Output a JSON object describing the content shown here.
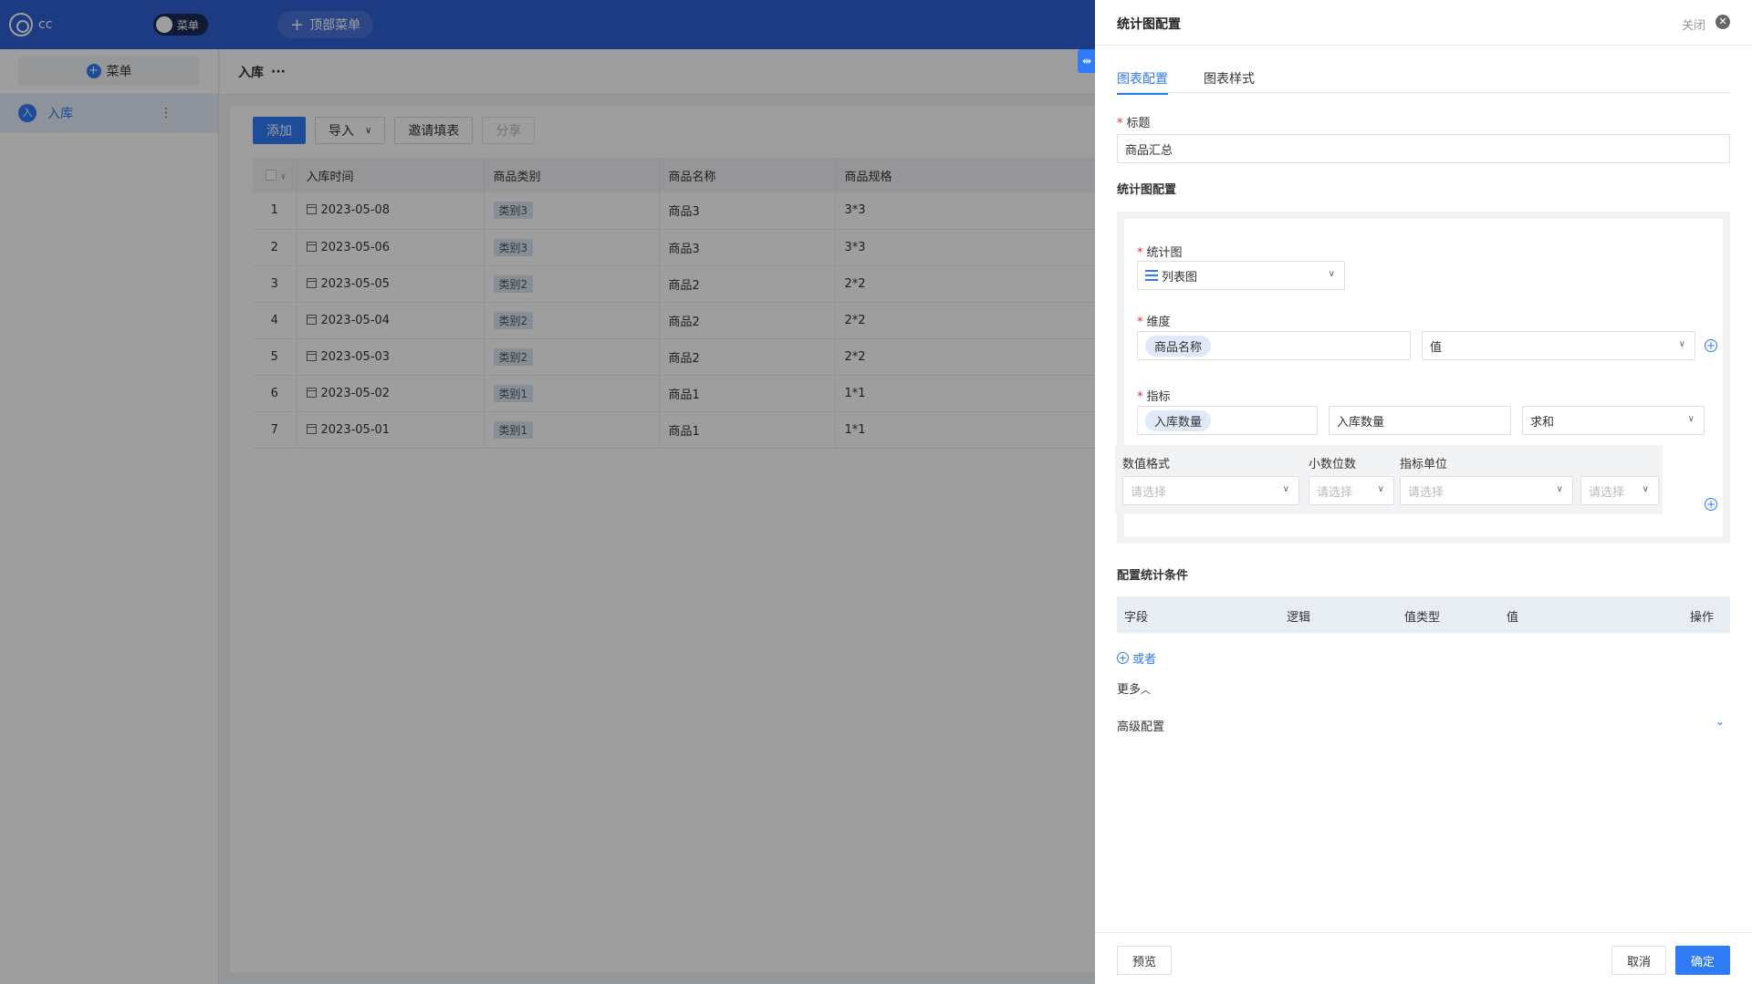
{
  "app": {
    "logo_text": "cc",
    "toggle_label": "菜单",
    "top_menu_label": "顶部菜单"
  },
  "sidebar": {
    "menu_button": "菜单",
    "items": [
      {
        "badge": "入",
        "label": "入库",
        "more": "⋮"
      }
    ]
  },
  "page": {
    "title": "入库",
    "more": "···"
  },
  "toolbar": {
    "add": "添加",
    "import": "导入",
    "invite": "邀请填表",
    "share": "分享"
  },
  "table": {
    "columns": [
      "入库时间",
      "商品类别",
      "商品名称",
      "商品规格"
    ],
    "rows": [
      {
        "idx": "1",
        "date": "2023-05-08",
        "category": "类别3",
        "name": "商品3",
        "spec": "3*3"
      },
      {
        "idx": "2",
        "date": "2023-05-06",
        "category": "类别3",
        "name": "商品3",
        "spec": "3*3"
      },
      {
        "idx": "3",
        "date": "2023-05-05",
        "category": "类别2",
        "name": "商品2",
        "spec": "2*2"
      },
      {
        "idx": "4",
        "date": "2023-05-04",
        "category": "类别2",
        "name": "商品2",
        "spec": "2*2"
      },
      {
        "idx": "5",
        "date": "2023-05-03",
        "category": "类别2",
        "name": "商品2",
        "spec": "2*2"
      },
      {
        "idx": "6",
        "date": "2023-05-02",
        "category": "类别1",
        "name": "商品1",
        "spec": "1*1"
      },
      {
        "idx": "7",
        "date": "2023-05-01",
        "category": "类别1",
        "name": "商品1",
        "spec": "1*1"
      }
    ]
  },
  "drawer": {
    "title": "统计图配置",
    "close_label": "关闭",
    "tabs": {
      "config": "图表配置",
      "style": "图表样式"
    },
    "title_label": "标题",
    "title_value": "商品汇总",
    "stats_section": "统计图配置",
    "chart_label": "统计图",
    "chart_value": "列表图",
    "dimension_label": "维度",
    "dimension_pill": "商品名称",
    "dimension_select": "值",
    "metric_label": "指标",
    "metric_pill": "入库数量",
    "metric_alias": "入库数量",
    "metric_agg": "求和",
    "number_format_label": "数值格式",
    "decimals_label": "小数位数",
    "unit_label": "指标单位",
    "placeholder": "请选择",
    "conditions_section": "配置统计条件",
    "cond_columns": {
      "field": "字段",
      "logic": "逻辑",
      "value_type": "值类型",
      "value": "值",
      "action": "操作"
    },
    "or_label": "或者",
    "more_label": "更多",
    "advanced_label": "高级配置",
    "preview": "预览",
    "cancel": "取消",
    "confirm": "确定"
  }
}
